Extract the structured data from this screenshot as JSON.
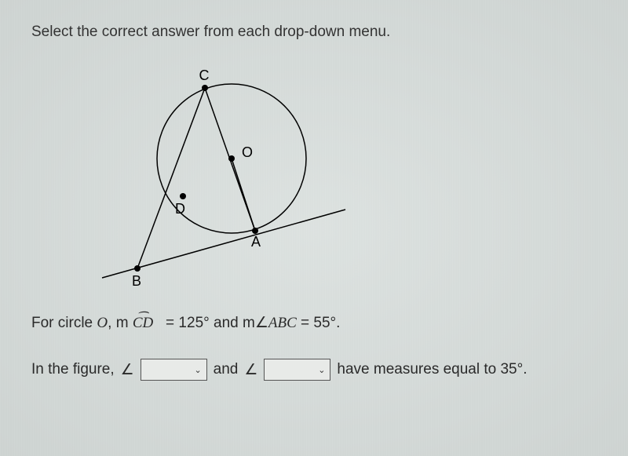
{
  "instruction": "Select the correct answer from each drop-down menu.",
  "figure": {
    "labels": {
      "C": "C",
      "O": "O",
      "D": "D",
      "A": "A",
      "B": "B"
    }
  },
  "problem": {
    "prefix": "For circle ",
    "circleLabel": "O",
    "arcPrefix": ", m ",
    "arcLabel": "CD",
    "equals": " = 125° and m",
    "angleABC": "ABC",
    "equals2": " = 55°.",
    "answerPrefix": "In the figure, ",
    "andText": " and ",
    "answerSuffix": " have measures equal to 35°."
  },
  "chart_data": {
    "type": "diagram",
    "description": "Circle O with tangent line through B touching at A, secant through B intersecting circle at D and C",
    "points": {
      "B": "external point (tangent-secant vertex)",
      "A": "point of tangency",
      "D": "near secant intersection",
      "C": "far secant intersection",
      "O": "center"
    },
    "given": {
      "arc_CD_degrees": 125,
      "angle_ABC_degrees": 55
    },
    "unknown": {
      "angles_equal_to_35": [
        "dropdown1",
        "dropdown2"
      ]
    }
  }
}
